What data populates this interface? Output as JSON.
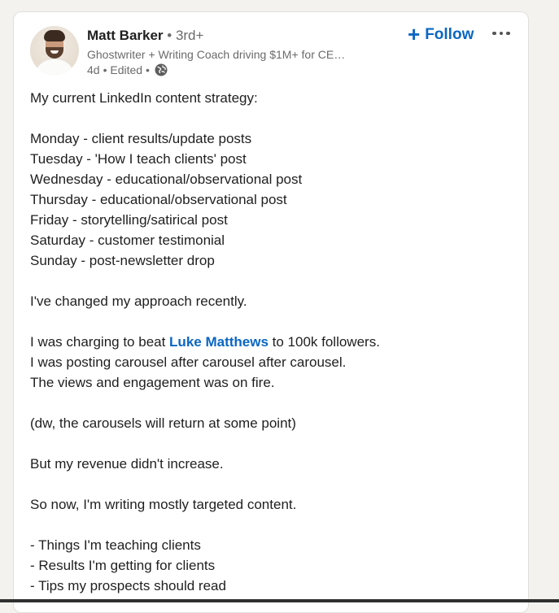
{
  "author": {
    "name": "Matt Barker",
    "degree": " • 3rd+",
    "headline": "Ghostwriter + Writing Coach driving $1M+ for CE…",
    "time": "4d",
    "edited": "• Edited •"
  },
  "actions": {
    "follow_icon": "+",
    "follow_label": "Follow",
    "more_icon": "ellipsis-icon"
  },
  "post": {
    "intro": "My current LinkedIn content strategy:",
    "schedule": [
      "Monday - client results/update posts",
      "Tuesday - 'How I teach clients' post",
      "Wednesday - educational/observational post",
      "Thursday - educational/observational post",
      "Friday - storytelling/satirical post",
      "Saturday - customer testimonial",
      "Sunday - post-newsletter drop"
    ],
    "changed": "I've changed my approach recently.",
    "charging_before": "I was charging to beat ",
    "mention": "Luke Matthews",
    "charging_after": " to 100k followers.",
    "carousel_line": "I was posting carousel after carousel after carousel.",
    "views_line": "The views and engagement was on fire.",
    "aside": "(dw, the carousels will return at some point)",
    "revenue": "But my revenue didn't increase.",
    "now": "So now, I'm writing mostly targeted content.",
    "bullets": [
      "- Things I'm teaching clients",
      "- Results I'm getting for clients",
      "- Tips my prospects should read"
    ]
  },
  "colors": {
    "link": "#0a66c2",
    "text": "#1f1f1f",
    "muted": "#6b6b6b"
  }
}
